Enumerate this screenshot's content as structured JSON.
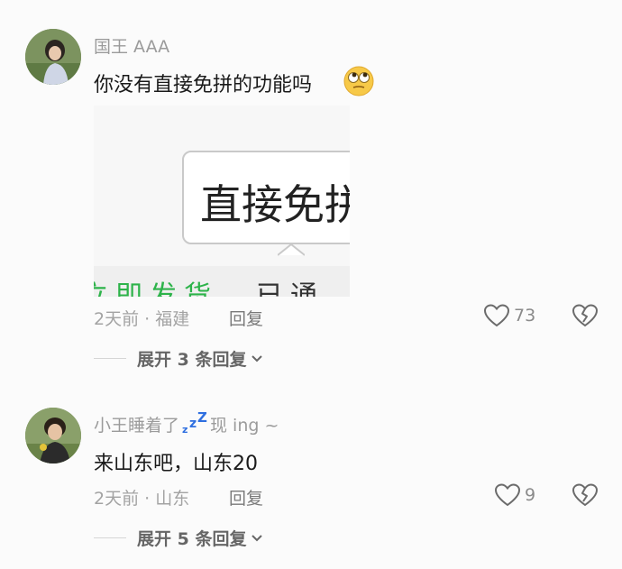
{
  "comments": [
    {
      "username": "国王 AAA",
      "text": "你没有直接免拼的功能吗",
      "time": "2天前",
      "location": "福建",
      "reply_label": "回复",
      "likes": "73",
      "expand_label": "展开 3 条回复",
      "image": {
        "main_text": "直接免拼",
        "bottom_green_text": "立即发货",
        "bottom_gray_text": "已通"
      }
    },
    {
      "username": "小王睡着了",
      "username_suffix": "现 ing ~",
      "text": "来山东吧，山东20",
      "time": "2天前",
      "location": "山东",
      "reply_label": "回复",
      "likes": "9",
      "expand_label": "展开 5 条回复"
    }
  ],
  "separator": "·",
  "icons": {
    "emoji": "rolling-eyes-emoji-icon",
    "zzz": "zzz-icon",
    "like": "heart-icon",
    "dislike": "broken-heart-icon",
    "chevron": "chevron-down-icon"
  },
  "colors": {
    "zzz": "#2f6fe0",
    "green": "#2db34a"
  }
}
